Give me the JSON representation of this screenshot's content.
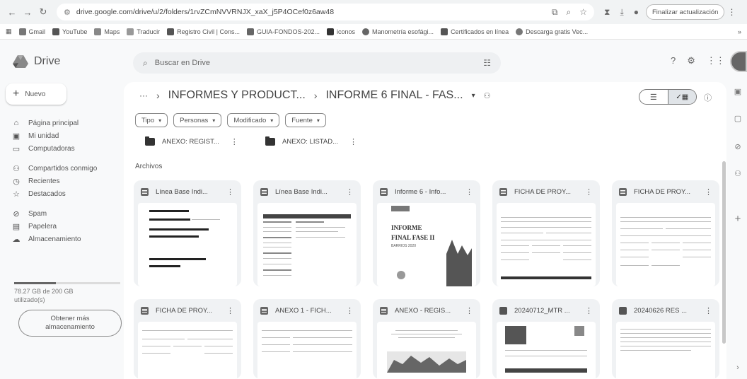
{
  "browser": {
    "url": "drive.google.com/drive/u/2/folders/1rvZCmNVVRNJX_xaX_j5P4OCef0z6aw48",
    "update_label": "Finalizar actualización",
    "bookmarks": [
      {
        "label": "Gmail",
        "color": "#777777"
      },
      {
        "label": "YouTube",
        "color": "#555555"
      },
      {
        "label": "Maps",
        "color": "#888888"
      },
      {
        "label": "Traducir",
        "color": "#999999"
      },
      {
        "label": "Registro Civil | Cons...",
        "color": "#555555"
      },
      {
        "label": "GUIA-FONDOS-202...",
        "color": "#666666"
      },
      {
        "label": "iconos",
        "color": "#333333"
      },
      {
        "label": "Manometría esofági...",
        "color": "#666666"
      },
      {
        "label": "Certificados en línea",
        "color": "#555555"
      },
      {
        "label": "Descarga gratis Vec...",
        "color": "#777777"
      }
    ],
    "bookmarks_more": "»"
  },
  "header": {
    "app_name": "Drive",
    "search_placeholder": "Buscar en Drive"
  },
  "sidebar": {
    "new_label": "Nuevo",
    "items": [
      {
        "label": "Página principal",
        "icon": "home-icon"
      },
      {
        "label": "Mi unidad",
        "icon": "my-drive-icon"
      },
      {
        "label": "Computadoras",
        "icon": "computer-icon"
      },
      {
        "label": "Compartidos conmigo",
        "icon": "shared-icon"
      },
      {
        "label": "Recientes",
        "icon": "clock-icon"
      },
      {
        "label": "Destacados",
        "icon": "star-icon"
      },
      {
        "label": "Spam",
        "icon": "spam-icon"
      },
      {
        "label": "Papelera",
        "icon": "trash-icon"
      },
      {
        "label": "Almacenamiento",
        "icon": "cloud-icon"
      }
    ],
    "storage_text": "78.27 GB de 200 GB utilizado(s)",
    "storage_fraction": 0.39,
    "get_more_label": "Obtener más almacenamiento"
  },
  "main": {
    "breadcrumb_parent": "INFORMES Y PRODUCT...",
    "breadcrumb_current": "INFORME 6 FINAL - FAS...",
    "filters": [
      "Tipo",
      "Personas",
      "Modificado",
      "Fuente"
    ],
    "folders": [
      {
        "name": "ANEXO: REGIST..."
      },
      {
        "name": "ANEXO: LISTAD..."
      }
    ],
    "files_title": "Archivos",
    "files": [
      {
        "name": "Línea Base Indi...",
        "type": "doc"
      },
      {
        "name": "Línea Base Indi...",
        "type": "doc"
      },
      {
        "name": "Informe 6 - Info...",
        "type": "doc"
      },
      {
        "name": "FICHA DE PROY...",
        "type": "doc"
      },
      {
        "name": "FICHA DE PROY...",
        "type": "doc"
      },
      {
        "name": "FICHA DE PROY...",
        "type": "doc"
      },
      {
        "name": "ANEXO 1 - FICH...",
        "type": "doc"
      },
      {
        "name": "ANEXO - REGIS...",
        "type": "doc"
      },
      {
        "name": "20240712_MTR ...",
        "type": "image"
      },
      {
        "name": "20240626 RES ...",
        "type": "image"
      }
    ],
    "informe_thumb_title": "INFORME",
    "informe_thumb_subtitle": "FINAL FASE II",
    "informe_thumb_small": "BARRIOS 2020"
  }
}
